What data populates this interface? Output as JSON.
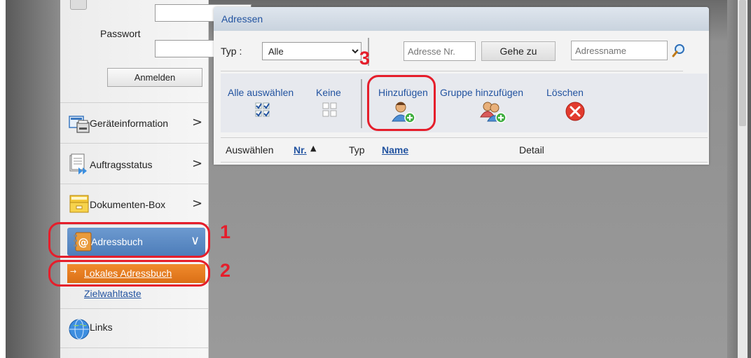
{
  "sidebar": {
    "password_label": "Passwort",
    "login_button": "Anmelden",
    "items": [
      {
        "label": "Geräteinformation",
        "icon": "device-info-icon",
        "chevron": ">"
      },
      {
        "label": "Auftragsstatus",
        "icon": "job-status-icon",
        "chevron": ">"
      },
      {
        "label": "Dokumenten-Box",
        "icon": "document-box-icon",
        "chevron": ">"
      },
      {
        "label": "Adressbuch",
        "icon": "address-book-icon",
        "chevron": "∨"
      },
      {
        "label": "Links",
        "icon": "globe-icon"
      }
    ],
    "subitems": [
      {
        "label": "Lokales Adressbuch"
      },
      {
        "label": "Zielwahltaste"
      }
    ]
  },
  "callouts": {
    "c1": "1",
    "c2": "2",
    "c3": "3"
  },
  "panel": {
    "title": "Adressen",
    "type_label": "Typ :",
    "type_value": "Alle",
    "address_no_placeholder": "Adresse Nr.",
    "goto_button": "Gehe zu",
    "address_name_placeholder": "Adressname",
    "actions": {
      "select_all": "Alle auswählen",
      "none": "Keine",
      "add": "Hinzufügen",
      "add_group": "Gruppe hinzufügen",
      "delete": "Löschen"
    },
    "columns": {
      "select": "Auswählen",
      "no": "Nr.",
      "type": "Typ",
      "name": "Name",
      "detail": "Detail"
    }
  },
  "colors": {
    "accent_blue": "#2253a0",
    "callout_red": "#e51e2b",
    "active_nav": "#5a88c4",
    "active_sub": "#e67d22"
  }
}
